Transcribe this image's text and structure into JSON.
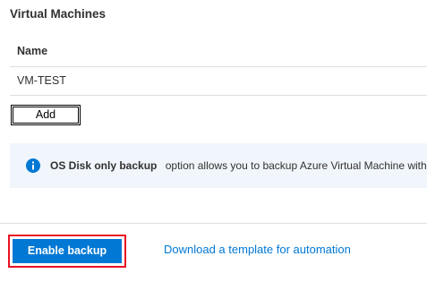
{
  "section": {
    "title": "Virtual Machines"
  },
  "vm_table": {
    "columns": [
      "Name"
    ],
    "rows": [
      {
        "name": "VM-TEST"
      }
    ]
  },
  "add_button": {
    "label": "Add"
  },
  "info_banner": {
    "icon": "info-icon",
    "bold_text": "OS Disk only backup",
    "text": "option allows you to backup Azure Virtual Machine with"
  },
  "footer": {
    "enable_backup_label": "Enable backup",
    "download_template_label": "Download a template for automation"
  },
  "colors": {
    "primary": "#0078d4",
    "highlight": "#e81123",
    "info_background": "#f0f6fc"
  }
}
